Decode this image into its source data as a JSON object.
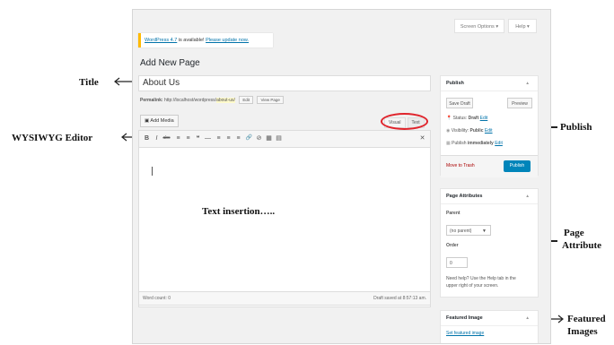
{
  "header": {
    "screen_options_label": "Screen Options ▾",
    "help_label": "Help ▾"
  },
  "notice": {
    "prefix": "WordPress 4.7",
    "middle": " is available! ",
    "link": "Please update now."
  },
  "page_heading": "Add New Page",
  "title_field": {
    "value": "About Us"
  },
  "permalink": {
    "label": "Permalink:",
    "base": "http://localhost/wordpress/",
    "slug": "about-us/",
    "edit_label": "Edit",
    "view_label": "View Page"
  },
  "editor": {
    "add_media_label": "Add Media",
    "tabs": {
      "visual": "Visual",
      "text": "Text"
    },
    "toolbar_icons": [
      "B",
      "I",
      "abc",
      "≡",
      "≡",
      "❝",
      "—",
      "≡",
      "≡",
      "≡",
      "🔗",
      "⊘",
      "▦",
      "▤"
    ],
    "body_text": "Text insertion…..",
    "word_count": "Word count: 0",
    "draft_saved": "Draft saved at 8:57:13 am."
  },
  "publish_box": {
    "title": "Publish",
    "save_draft_label": "Save Draft",
    "preview_label": "Preview",
    "status_label": "Status:",
    "status_value": "Draft",
    "visibility_label": "Visibility:",
    "visibility_value": "Public",
    "schedule_label": "Publish",
    "schedule_value": "immediately",
    "edit_label": "Edit",
    "trash_label": "Move to Trash",
    "publish_label": "Publish"
  },
  "page_attributes_box": {
    "title": "Page Attributes",
    "parent_label": "Parent",
    "parent_value": "(no parent)",
    "order_label": "Order",
    "order_value": "0",
    "help_text_line1": "Need help? Use the Help tab in the",
    "help_text_line2": "upper right of your screen."
  },
  "featured_image_box": {
    "title": "Featured Image",
    "link_label": "Set featured image"
  },
  "annotations": {
    "title": "Title",
    "wysiwyg": "WYSIWYG Editor",
    "publish": "Publish",
    "page_attribute_line1": "Page",
    "page_attribute_line2": "Attribute",
    "featured_line1": "Featured",
    "featured_line2": "Images"
  },
  "colors": {
    "accent_blue": "#0085ba",
    "link_blue": "#0073aa",
    "highlight_red": "#e0242c",
    "notice_yellow": "#ffba00"
  }
}
